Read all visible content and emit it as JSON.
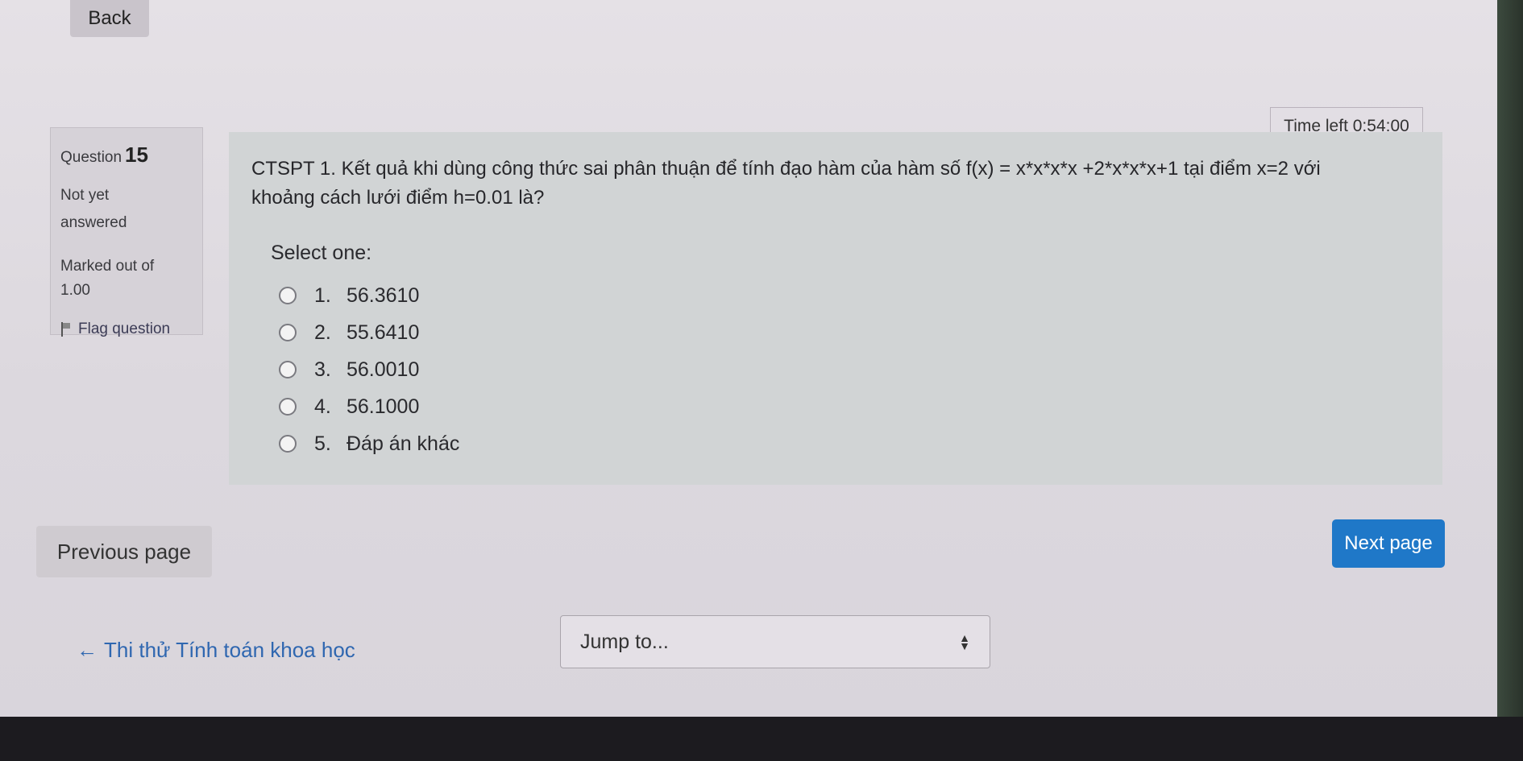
{
  "nav": {
    "back_label": "Back"
  },
  "timer": {
    "label": "Time left",
    "value": "0:54:00"
  },
  "question_info": {
    "question_word": "Question",
    "number": "15",
    "state_line1": "Not yet",
    "state_line2": "answered",
    "grade_line1": "Marked out of",
    "grade_line2": "1.00",
    "flag_label": "Flag question"
  },
  "question": {
    "text_line1": "CTSPT 1. Kết quả khi dùng công thức sai phân thuận để tính đạo hàm của hàm số f(x) = x*x*x*x +2*x*x*x+1 tại điểm x=2 với",
    "text_line2": "khoảng cách lưới điểm h=0.01 là?",
    "select_label": "Select one:",
    "options": [
      {
        "num": "1.",
        "text": "56.3610"
      },
      {
        "num": "2.",
        "text": "55.6410"
      },
      {
        "num": "3.",
        "text": "56.0010"
      },
      {
        "num": "4.",
        "text": "56.1000"
      },
      {
        "num": "5.",
        "text": "Đáp án khác"
      }
    ]
  },
  "footer": {
    "prev_label": "Previous page",
    "next_label": "Next page",
    "course_link": "Thi thử Tính toán khoa học",
    "jump_placeholder": "Jump to..."
  }
}
